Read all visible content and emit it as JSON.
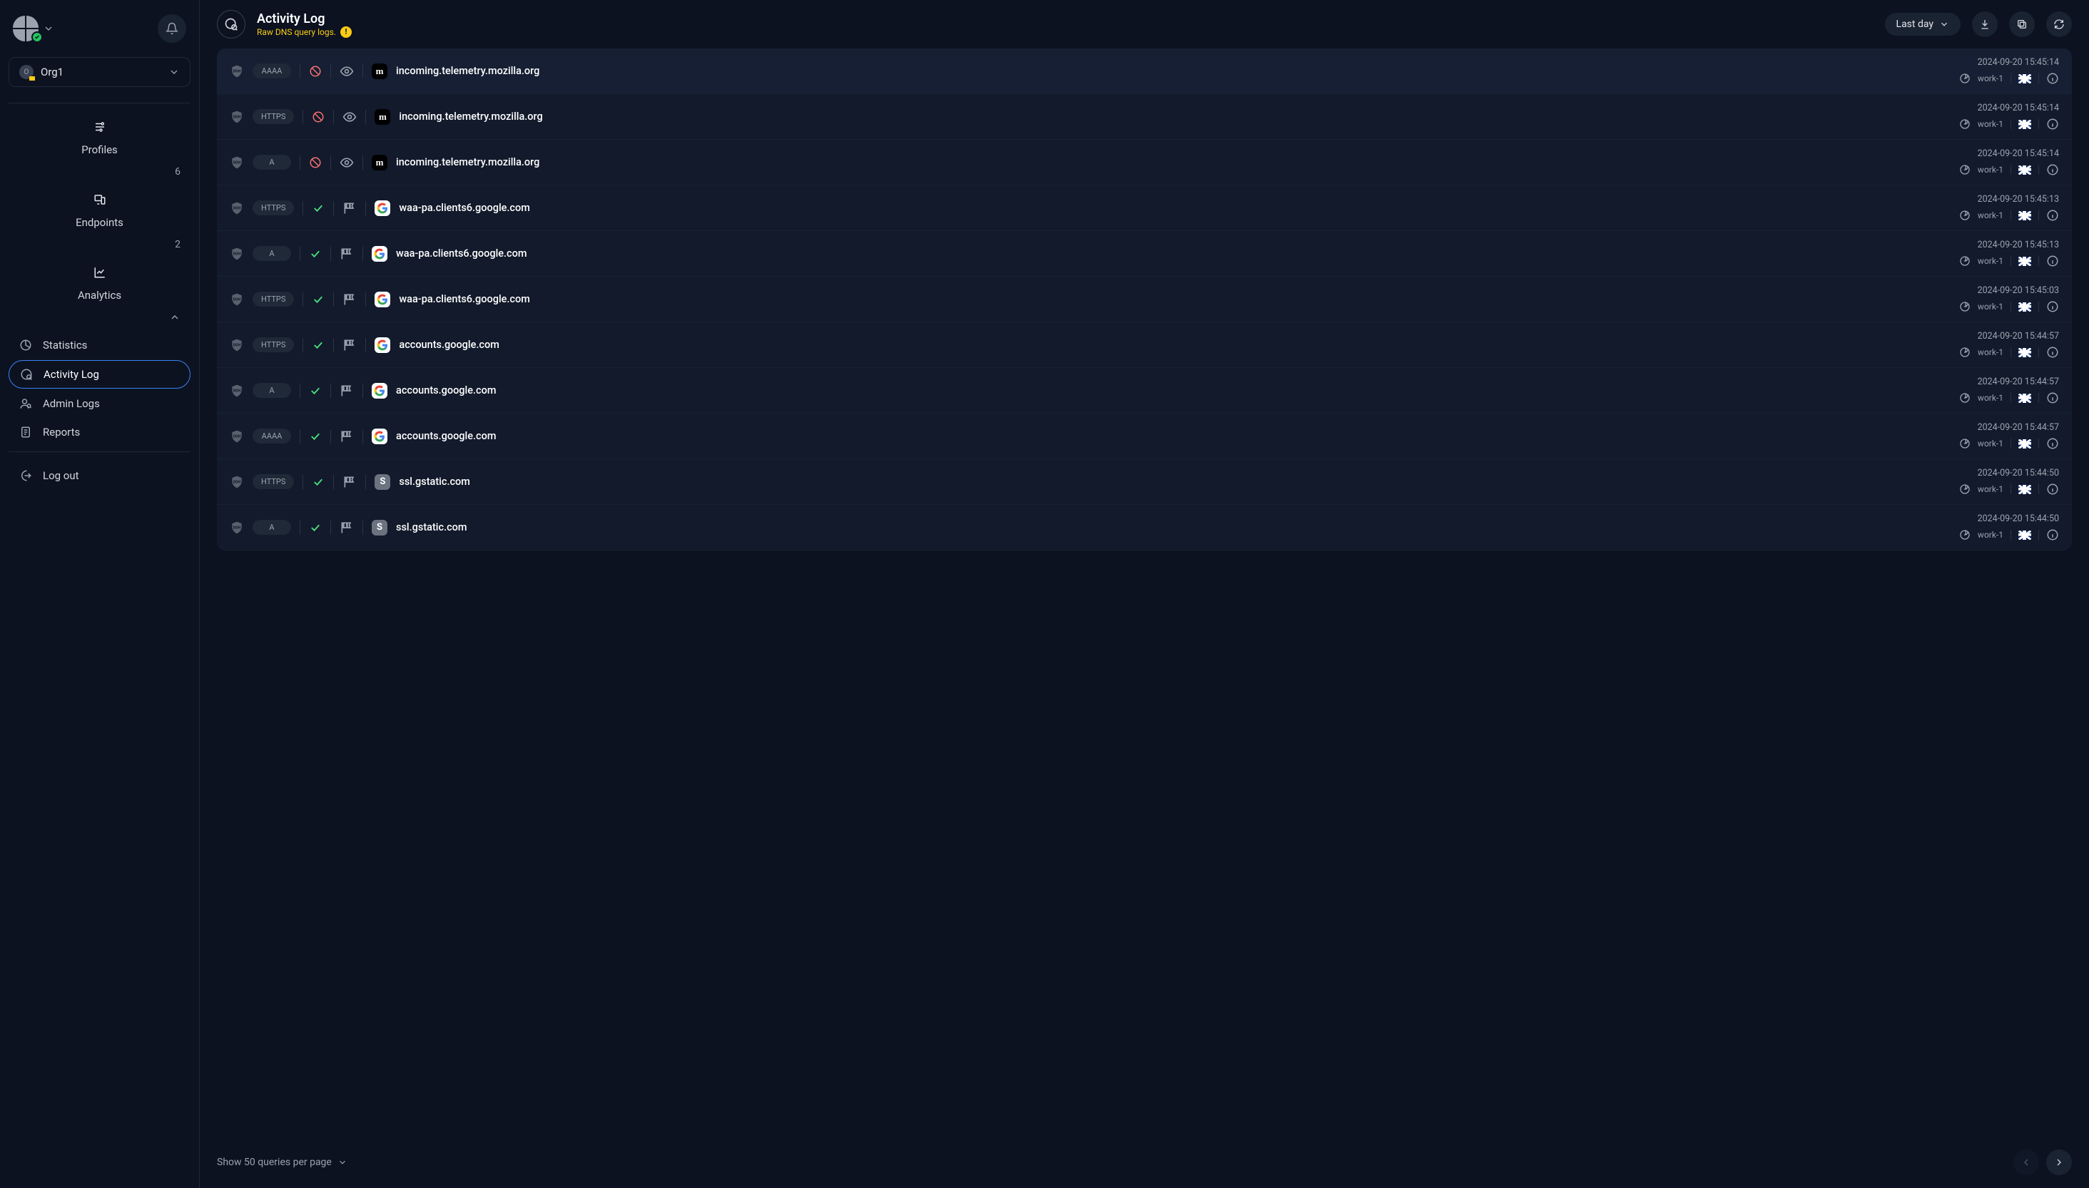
{
  "sidebar": {
    "org_name": "Org1",
    "nav": {
      "profiles": {
        "label": "Profiles",
        "count": "6"
      },
      "endpoints": {
        "label": "Endpoints",
        "count": "2"
      },
      "analytics": {
        "label": "Analytics"
      },
      "statistics": {
        "label": "Statistics"
      },
      "activity_log": {
        "label": "Activity Log"
      },
      "admin_logs": {
        "label": "Admin Logs"
      },
      "reports": {
        "label": "Reports"
      },
      "logout": {
        "label": "Log out"
      }
    }
  },
  "header": {
    "title": "Activity Log",
    "subtitle": "Raw DNS query logs.",
    "time_range": "Last day"
  },
  "logs": [
    {
      "qtype": "AAAA",
      "status": "blocked",
      "action": "eye",
      "fav": "m",
      "domain": "incoming.telemetry.mozilla.org",
      "timestamp": "2024-09-20 15:45:14",
      "endpoint": "work-1"
    },
    {
      "qtype": "HTTPS",
      "status": "blocked",
      "action": "eye",
      "fav": "m",
      "domain": "incoming.telemetry.mozilla.org",
      "timestamp": "2024-09-20 15:45:14",
      "endpoint": "work-1"
    },
    {
      "qtype": "A",
      "status": "blocked",
      "action": "eye",
      "fav": "m",
      "domain": "incoming.telemetry.mozilla.org",
      "timestamp": "2024-09-20 15:45:14",
      "endpoint": "work-1"
    },
    {
      "qtype": "HTTPS",
      "status": "allowed",
      "action": "flag",
      "fav": "g",
      "domain": "waa-pa.clients6.google.com",
      "timestamp": "2024-09-20 15:45:13",
      "endpoint": "work-1"
    },
    {
      "qtype": "A",
      "status": "allowed",
      "action": "flag",
      "fav": "g",
      "domain": "waa-pa.clients6.google.com",
      "timestamp": "2024-09-20 15:45:13",
      "endpoint": "work-1"
    },
    {
      "qtype": "HTTPS",
      "status": "allowed",
      "action": "flag",
      "fav": "g",
      "domain": "waa-pa.clients6.google.com",
      "timestamp": "2024-09-20 15:45:03",
      "endpoint": "work-1"
    },
    {
      "qtype": "HTTPS",
      "status": "allowed",
      "action": "flag",
      "fav": "g",
      "domain": "accounts.google.com",
      "timestamp": "2024-09-20 15:44:57",
      "endpoint": "work-1"
    },
    {
      "qtype": "A",
      "status": "allowed",
      "action": "flag",
      "fav": "g",
      "domain": "accounts.google.com",
      "timestamp": "2024-09-20 15:44:57",
      "endpoint": "work-1"
    },
    {
      "qtype": "AAAA",
      "status": "allowed",
      "action": "flag",
      "fav": "g",
      "domain": "accounts.google.com",
      "timestamp": "2024-09-20 15:44:57",
      "endpoint": "work-1"
    },
    {
      "qtype": "HTTPS",
      "status": "allowed",
      "action": "flag",
      "fav": "s",
      "domain": "ssl.gstatic.com",
      "timestamp": "2024-09-20 15:44:50",
      "endpoint": "work-1"
    },
    {
      "qtype": "A",
      "status": "allowed",
      "action": "flag",
      "fav": "s",
      "domain": "ssl.gstatic.com",
      "timestamp": "2024-09-20 15:44:50",
      "endpoint": "work-1"
    }
  ],
  "footer": {
    "pager_label": "Show 50 queries per page"
  }
}
